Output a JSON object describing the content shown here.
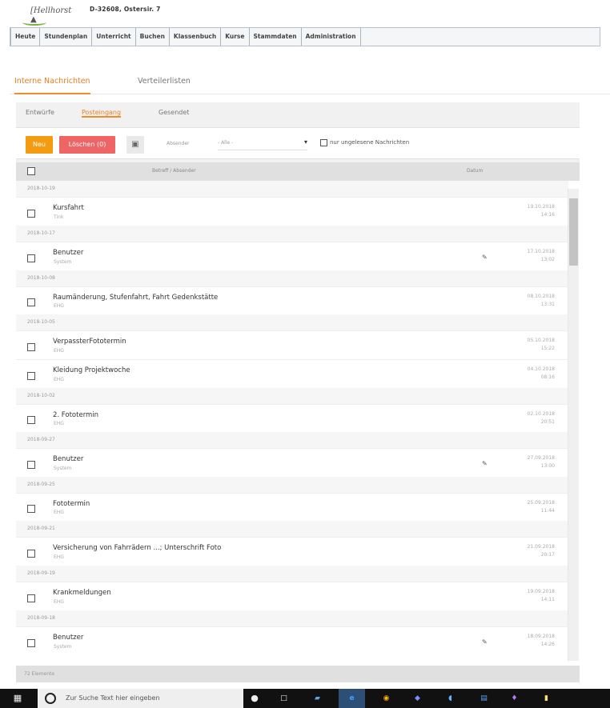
{
  "header": {
    "logo_text": "[Hellhorst ▲",
    "address": "D-32608, Ostersir. 7"
  },
  "main_menu": [
    "Heute",
    "Stundenplan",
    "Unterricht",
    "Buchen",
    "Klassenbuch",
    "Kurse",
    "Stammdaten",
    "Administration"
  ],
  "message_tabs": [
    {
      "label": "Interne Nachrichten",
      "active": true
    },
    {
      "label": "Verteilerlisten",
      "active": false
    }
  ],
  "folder_tabs": [
    {
      "label": "Entwürfe",
      "active": false
    },
    {
      "label": "Posteingang",
      "active": true
    },
    {
      "label": "Gesendet",
      "active": false
    }
  ],
  "toolbar": {
    "new_label": "Neu",
    "delete_label": "Löschen (0)",
    "inbox_icon": "inbox-icon",
    "sender_label": "Absender",
    "sender_value": "- Alle -",
    "unread_only_label": "nur ungelesene Nachrichten"
  },
  "list": {
    "column_subject": "Betreff / Absender",
    "column_date": "Datum",
    "messages": [
      {
        "group": "2018-10-19",
        "subject": "Kursfahrt",
        "sender": "Tink",
        "date": "19.10.2018",
        "time": "14:16",
        "icon": ""
      },
      {
        "group": "2018-10-17",
        "subject": "Benutzer",
        "sender": "System",
        "date": "17.10.2018",
        "time": "13:02",
        "icon": "edit-icon"
      },
      {
        "group": "2018-10-08",
        "subject": "Raumänderung, Stufenfahrt, Fahrt Gedenkstätte",
        "sender": "EHG",
        "date": "08.10.2018",
        "time": "13:31",
        "icon": ""
      },
      {
        "group": "2018-10-05",
        "subject": "VerpassterFototermin",
        "sender": "EHG",
        "date": "05.10.2018",
        "time": "15:22",
        "icon": ""
      },
      {
        "group": "",
        "subject": "Kleidung Projektwoche",
        "sender": "EHG",
        "date": "04.10.2018",
        "time": "08:16",
        "icon": ""
      },
      {
        "group": "2018-10-02",
        "subject": "2. Fototermin",
        "sender": "EHG",
        "date": "02.10.2018",
        "time": "20:51",
        "icon": ""
      },
      {
        "group": "2018-09-27",
        "subject": "Benutzer",
        "sender": "System",
        "date": "27.09.2018",
        "time": "13:00",
        "icon": "edit-icon"
      },
      {
        "group": "2018-09-25",
        "subject": "Fototermin",
        "sender": "EHG",
        "date": "25.09.2018",
        "time": "11:44",
        "icon": ""
      },
      {
        "group": "2018-09-21",
        "subject": "Versicherung von Fahrrädern ...; Unterschrift Foto",
        "sender": "EHG",
        "date": "21.09.2018",
        "time": "20:17",
        "icon": ""
      },
      {
        "group": "2018-09-19",
        "subject": "Krankmeldungen",
        "sender": "EHG",
        "date": "19.09.2018",
        "time": "14:11",
        "icon": ""
      },
      {
        "group": "2018-09-18",
        "subject": "Benutzer",
        "sender": "System",
        "date": "18.09.2018",
        "time": "14:26",
        "icon": "edit-icon"
      }
    ]
  },
  "footer": {
    "count": "72 Elemente"
  },
  "taskbar": {
    "windows_icon": "windows-icon",
    "search_placeholder": "Zur Suche Text hier eingeben"
  }
}
